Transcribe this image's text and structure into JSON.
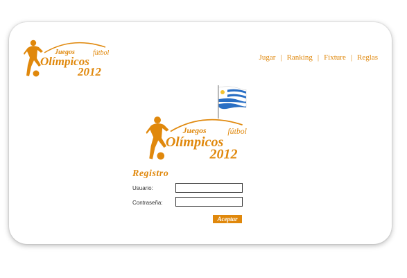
{
  "brand": {
    "logo_text_top": "Juegos",
    "logo_text_sport": "fútbol",
    "logo_text_main": "Olímpicos",
    "logo_text_year": "2012",
    "color": "#e0880c"
  },
  "nav": {
    "items": [
      "Jugar",
      "Ranking",
      "Fixture",
      "Reglas"
    ],
    "separator": "|"
  },
  "flag": {
    "icon": "uruguay-flag-icon"
  },
  "login": {
    "title": "Registro",
    "user_label": "Usuario:",
    "user_value": "",
    "password_label": "Contraseña:",
    "password_value": "",
    "submit_label": "Aceptar"
  }
}
